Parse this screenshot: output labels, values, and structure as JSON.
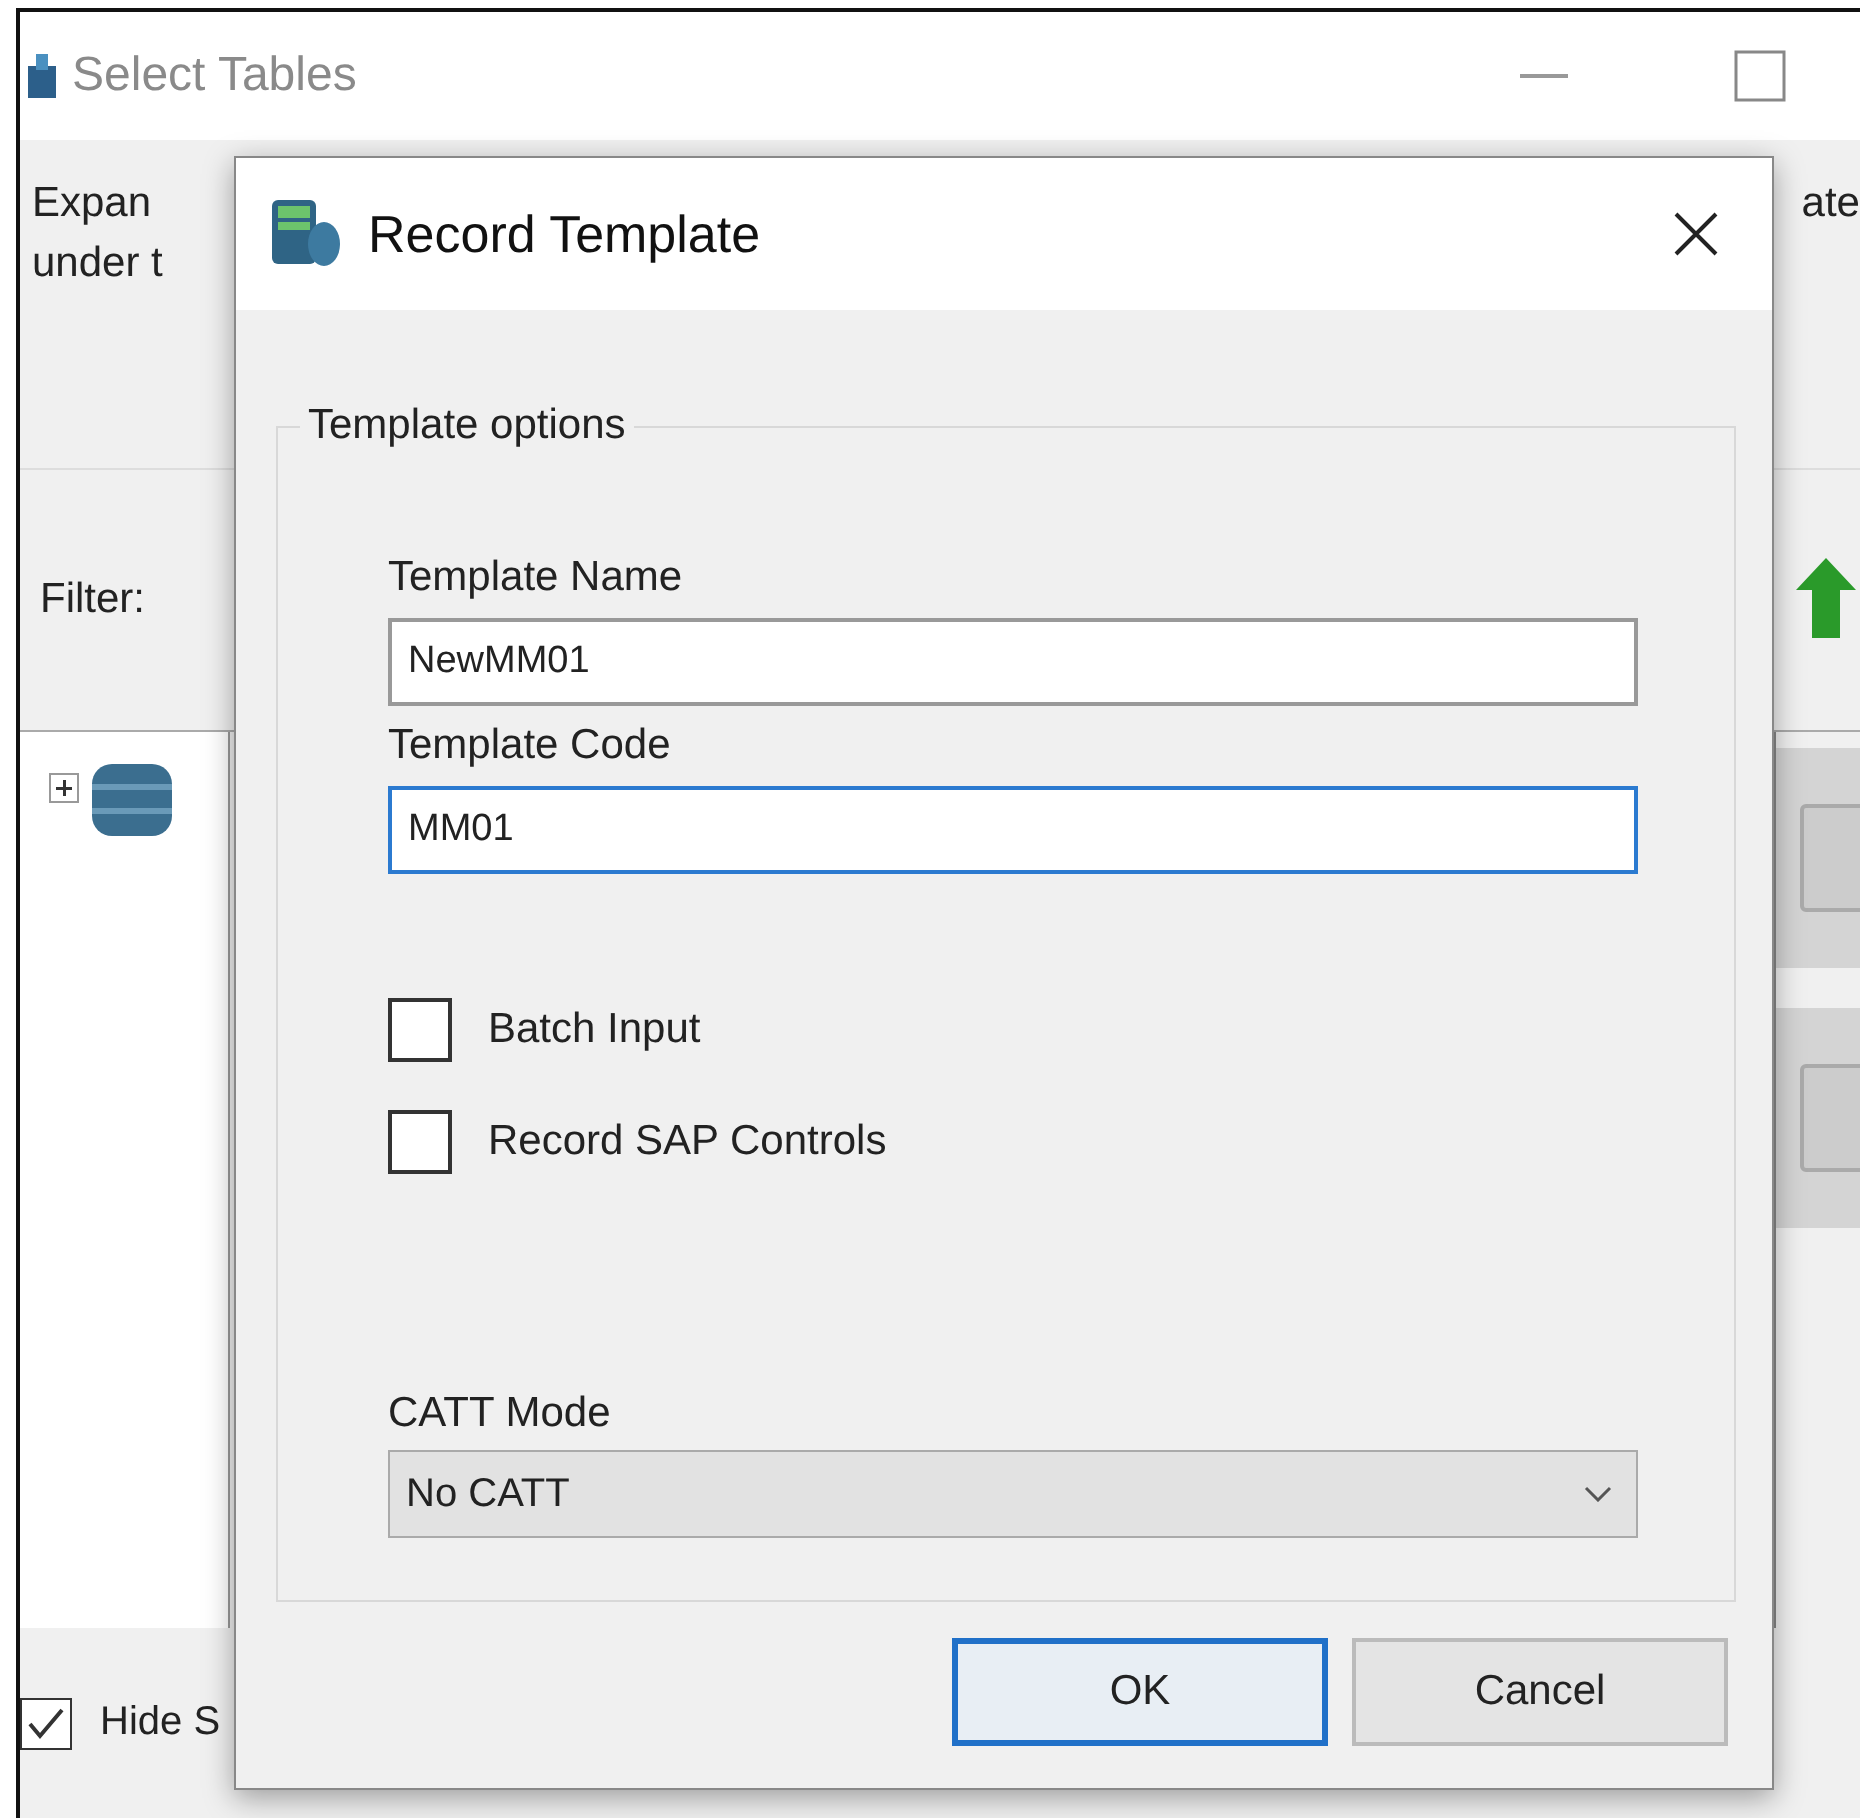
{
  "background_window": {
    "title": "Select Tables",
    "description_left": [
      "Expan",
      "under t"
    ],
    "description_right": "ate",
    "filter_label": "Filter:",
    "tree_node": {
      "expanded": false
    },
    "hide_checkbox": {
      "label": "Hide S",
      "checked": true
    }
  },
  "dialog": {
    "title": "Record Template",
    "group_title": "Template options",
    "fields": [
      {
        "label": "Template Name",
        "value": "NewMM01",
        "focused": false
      },
      {
        "label": "Template Code",
        "value": "MM01",
        "focused": true
      }
    ],
    "checkboxes": [
      {
        "label": "Batch Input",
        "checked": false
      },
      {
        "label": "Record SAP Controls",
        "checked": false
      }
    ],
    "catt_mode": {
      "label": "CATT Mode",
      "value": "No CATT"
    },
    "buttons": [
      {
        "label": "OK",
        "default": true
      },
      {
        "label": "Cancel",
        "default": false
      }
    ]
  }
}
